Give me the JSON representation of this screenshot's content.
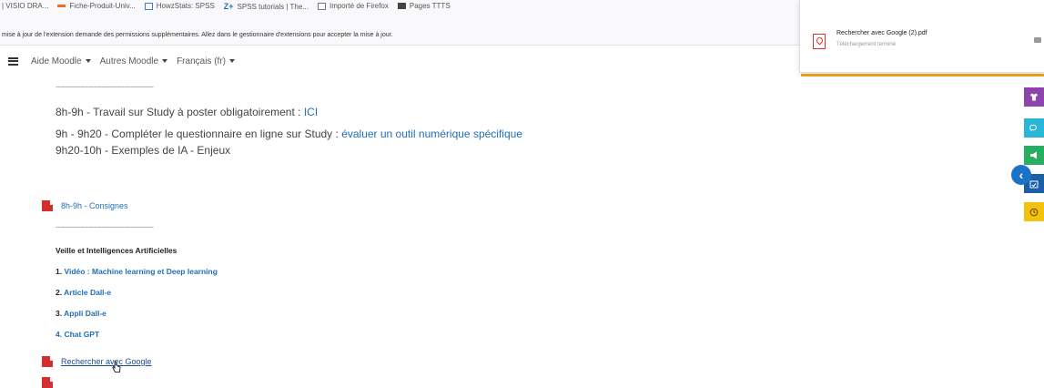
{
  "bookmarks": [
    {
      "label": "| VISIO DRA...",
      "color": "#888888"
    },
    {
      "label": "Fiche-Produit-Univ...",
      "color": "#f06e1e"
    },
    {
      "label": "HowzStats: SPSS",
      "color": "#3a7bd5"
    },
    {
      "label": "SPSS tutorials | The...",
      "color": "#2b6cb0"
    },
    {
      "label": "Importé de Firefox",
      "color": "#777777"
    },
    {
      "label": "Pages TTTS",
      "color": "#444444"
    }
  ],
  "notice": "mise à jour de l'extension demande des permissions supplémentaires. Allez dans le gestionnaire d'extensions pour accepter la mise à jour.",
  "navbar": {
    "items": [
      "Aide Moodle",
      "Autres Moodle",
      "Français (fr)"
    ]
  },
  "downloads": {
    "filename": "Rechercher avec Google (2).pdf",
    "status": "Téléchargement terminé"
  },
  "content": {
    "separator": "-------------------------------------------",
    "line1_text": "8h-9h - Travail sur Study à poster obligatoirement : ",
    "line1_link": "ICI",
    "line2_text": "9h - 9h20 - Compléter le questionnaire en ligne sur Study : ",
    "line2_link": "évaluer un outil numérique spécifique",
    "line3_text": "9h20-10h - Exemples de IA - Enjeux",
    "resource1": "8h-9h - Consignes",
    "heading": "Veille et Intelligences Artificielles",
    "item1_num": "1. ",
    "item1_link": "Vidéo : Machine learning et Deep learning",
    "item2_num": "2. ",
    "item2_link": "Article Dall-e",
    "item3_num": "3. ",
    "item3_link": "Appli Dall-e",
    "item4_link": "4. Chat GPT",
    "resource2": "Rechercher avec Google"
  },
  "side_colors": {
    "purple": "#8e44ad",
    "cyan": "#29b6d8",
    "green": "#27ae60",
    "blue": "#1a5fa8",
    "yellow": "#f4c20d"
  }
}
